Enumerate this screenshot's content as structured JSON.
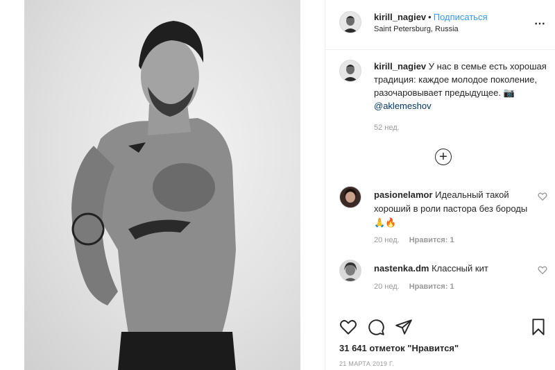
{
  "header": {
    "username": "kirill_nagiev",
    "dot": "•",
    "follow_label": "Подписаться",
    "location": "Saint Petersburg, Russia",
    "more_label": "⋯"
  },
  "caption": {
    "username": "kirill_nagiev",
    "text": "У нас в семье есть хорошая традиция: каждое молодое поколение, разочаровывает предыдущее. 📷",
    "mention": "@aklemeshov",
    "time": "52 нед."
  },
  "load_more_label": "+",
  "comments": [
    {
      "username": "pasionelamor",
      "text": "Идеальный такой хороший в роли пастора без бороды 🙏🔥",
      "time": "20 нед.",
      "likes": "Нравится: 1"
    },
    {
      "username": "nastenka.dm",
      "text": "Классный кит",
      "time": "20 нед.",
      "likes": "Нравится: 1"
    }
  ],
  "actions": {
    "like_icon": "heart-icon",
    "comment_icon": "comment-icon",
    "share_icon": "share-icon",
    "save_icon": "bookmark-icon"
  },
  "likes_count": "31 641 отметок \"Нравится\"",
  "post_date": "21 МАРТА 2019 Г."
}
